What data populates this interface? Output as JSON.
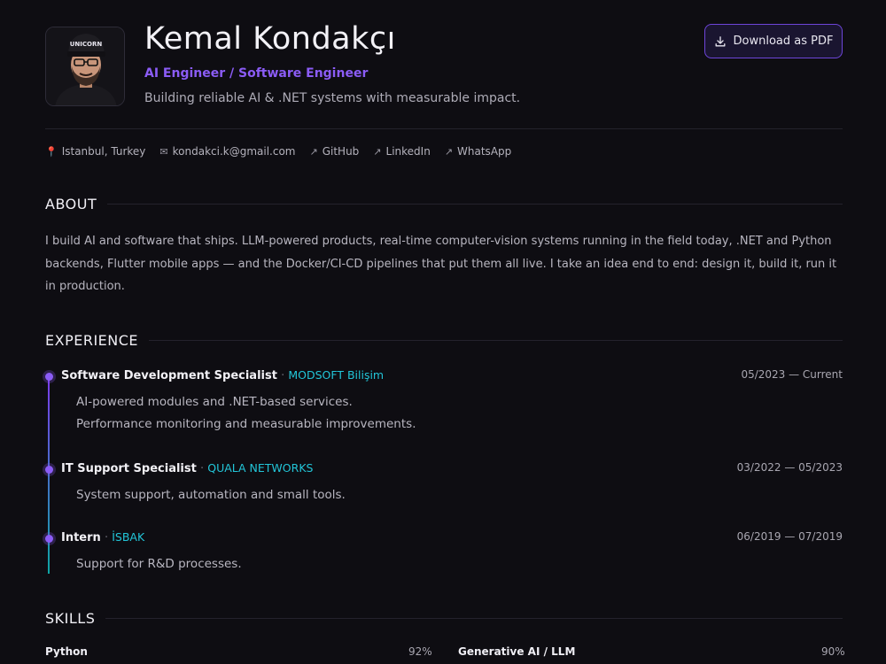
{
  "header": {
    "name": "Kemal Kondakçı",
    "role": "AI Engineer / Software Engineer",
    "tagline": "Building reliable AI & .NET systems with measurable impact.",
    "download_label": "Download as PDF",
    "avatar_cap_text": "UNICORN"
  },
  "contacts": [
    {
      "icon": "location-pin-icon",
      "text": "Istanbul, Turkey"
    },
    {
      "icon": "mail-icon",
      "text": "kondakci.k@gmail.com"
    },
    {
      "icon": "external-link-icon",
      "text": "GitHub"
    },
    {
      "icon": "external-link-icon",
      "text": "LinkedIn"
    },
    {
      "icon": "external-link-icon",
      "text": "WhatsApp"
    }
  ],
  "about": {
    "title": "ABOUT",
    "lines": [
      "I build AI and software that ships. LLM-powered products, real-time computer-vision systems running in the field today, .NET and Python",
      "backends, Flutter mobile apps — and the Docker/CI-CD pipelines that put them all live. I take an idea end to end: design it, build it, run it",
      "in production."
    ]
  },
  "experience": {
    "title": "EXPERIENCE",
    "jobs": [
      {
        "title": "Software Development Specialist",
        "company": "MODSOFT Bilişim",
        "dates": "05/2023 — Current",
        "bullets": [
          "AI-powered modules and .NET-based services.",
          "Performance monitoring and measurable improvements."
        ]
      },
      {
        "title": "IT Support Specialist",
        "company": "QUALA NETWORKS",
        "dates": "03/2022 — 05/2023",
        "bullets": [
          "System support, automation and small tools."
        ]
      },
      {
        "title": "Intern",
        "company": "İSBAK",
        "dates": "06/2019 — 07/2019",
        "bullets": [
          "Support for R&D processes."
        ]
      }
    ]
  },
  "skills": {
    "title": "SKILLS",
    "items": [
      {
        "name": "Python",
        "value": "92%"
      },
      {
        "name": "Generative AI / LLM",
        "value": "90%"
      }
    ]
  },
  "colors": {
    "accent_purple": "#8b5cf6",
    "accent_cyan": "#22c5d8",
    "background": "#0e0d12"
  }
}
